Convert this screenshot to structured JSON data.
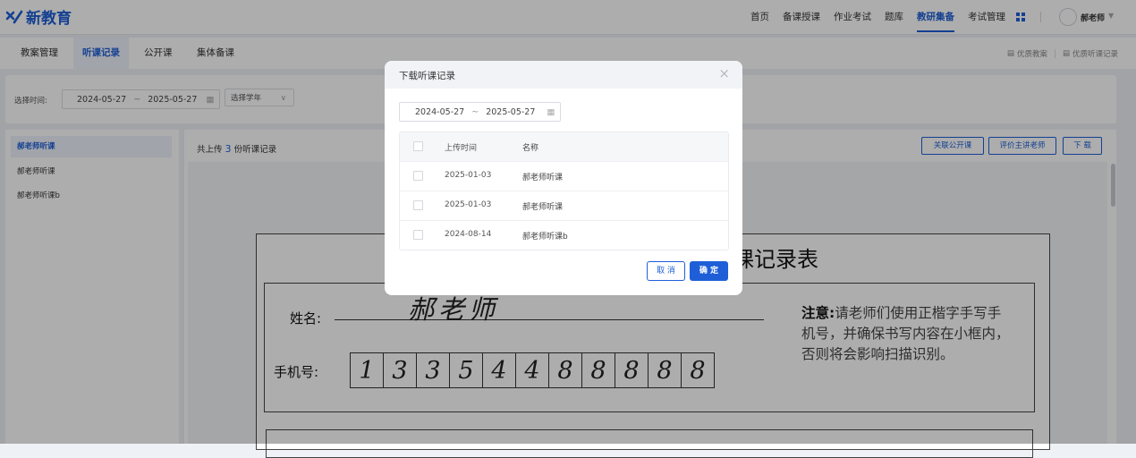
{
  "app": {
    "logo_text": "新教育",
    "brand_color": "#1e5fd8"
  },
  "topnav": {
    "items": [
      {
        "label": "首页"
      },
      {
        "label": "备课授课"
      },
      {
        "label": "作业考试"
      },
      {
        "label": "题库"
      },
      {
        "label": "教研集备",
        "active": true
      },
      {
        "label": "考试管理"
      }
    ],
    "user": {
      "name": "郝老师"
    }
  },
  "subnav": {
    "tabs": [
      {
        "label": "教案管理"
      },
      {
        "label": "听课记录",
        "active": true
      },
      {
        "label": "公开课"
      },
      {
        "label": "集体备课"
      }
    ],
    "links": [
      {
        "label": "优质教案"
      },
      {
        "label": "优质听课记录"
      }
    ]
  },
  "filter": {
    "label": "选择时间:",
    "date_start": "2024-05-27",
    "date_end": "2025-05-27",
    "separator": "~",
    "year_select": "选择学年"
  },
  "sidebar": {
    "items": [
      {
        "label": "郝老师听课",
        "active": true
      },
      {
        "label": "郝老师听课"
      },
      {
        "label": "郝老师听课b"
      }
    ]
  },
  "main": {
    "count_prefix": "共上传",
    "count": "3",
    "count_suffix": "份听课记录",
    "buttons": {
      "link_open_class": "关联公开课",
      "evaluate_teacher": "评价主讲老师",
      "download": "下 载"
    }
  },
  "document": {
    "title": "课记录表",
    "name_label": "姓名:",
    "signature": "郝老师",
    "phone_label": "手机号:",
    "phone_digits": [
      "1",
      "3",
      "3",
      "5",
      "4",
      "4",
      "8",
      "8",
      "8",
      "8",
      "8"
    ],
    "note_bold": "注意:",
    "note_text": "请老师们使用正楷字手写手机号，并确保书写内容在小框内，否则将会影响扫描识别。"
  },
  "modal": {
    "title": "下载听课记录",
    "date_start": "2024-05-27",
    "date_end": "2025-05-27",
    "separator": "~",
    "columns": {
      "time": "上传时间",
      "name": "名称"
    },
    "rows": [
      {
        "time": "2025-01-03",
        "name": "郝老师听课"
      },
      {
        "time": "2025-01-03",
        "name": "郝老师听课"
      },
      {
        "time": "2024-08-14",
        "name": "郝老师听课b"
      }
    ],
    "cancel_label": "取 消",
    "ok_label": "确 定"
  }
}
